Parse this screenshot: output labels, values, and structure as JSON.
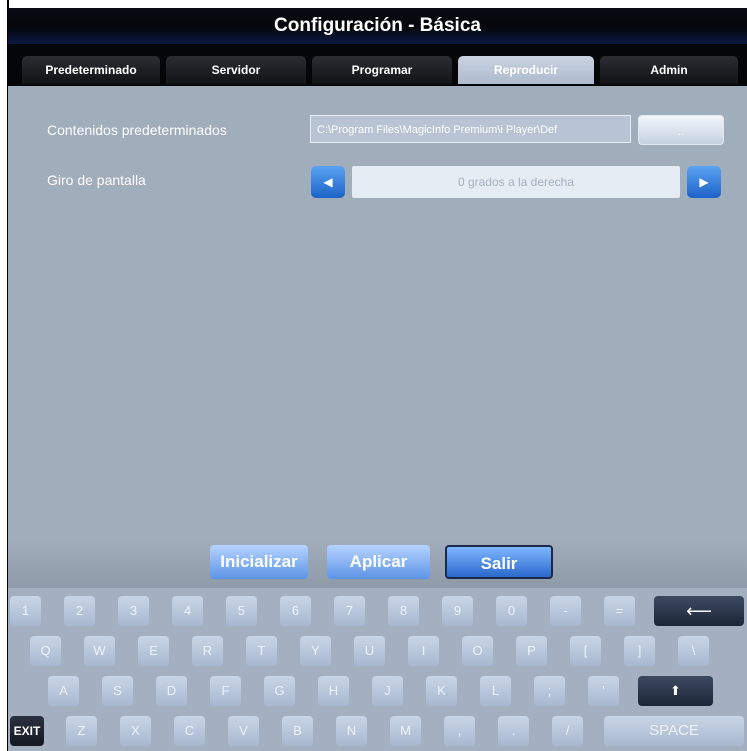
{
  "window": {
    "title": "Configuración - Básica"
  },
  "tabs": [
    {
      "label": "Predeterminado"
    },
    {
      "label": "Servidor"
    },
    {
      "label": "Programar"
    },
    {
      "label": "Reproducir",
      "active": true
    },
    {
      "label": "Admin"
    }
  ],
  "settings": {
    "default_content_label": "Contenidos predeterminados",
    "default_content_path": "C:\\Program Files\\MagicInfo Premium\\i Player\\Def",
    "browse_label": "..",
    "rotation_label": "Giro de pantalla",
    "rotation_value": "0 grados a la derecha"
  },
  "footer": {
    "init_label": "Inicializar",
    "apply_label": "Aplicar",
    "exit_label": "Salir"
  },
  "keyboard": {
    "row1": [
      "1",
      "2",
      "3",
      "4",
      "5",
      "6",
      "7",
      "8",
      "9",
      "0",
      "-",
      "="
    ],
    "row2": [
      "Q",
      "W",
      "E",
      "R",
      "T",
      "Y",
      "U",
      "I",
      "O",
      "P",
      "[",
      "]",
      "\\"
    ],
    "row3": [
      "A",
      "S",
      "D",
      "F",
      "G",
      "H",
      "J",
      "K",
      "L",
      ";",
      "'"
    ],
    "row4": [
      "Z",
      "X",
      "C",
      "V",
      "B",
      "N",
      "M",
      ",",
      ".",
      "/"
    ],
    "backspace": "⟵",
    "enter": "⬆",
    "exit_key": "EXIT",
    "space": "SPACE"
  },
  "colors": {
    "panel": "#a0adbb",
    "accent_blue": "#2a69cc",
    "titlebar": "#05070c"
  }
}
